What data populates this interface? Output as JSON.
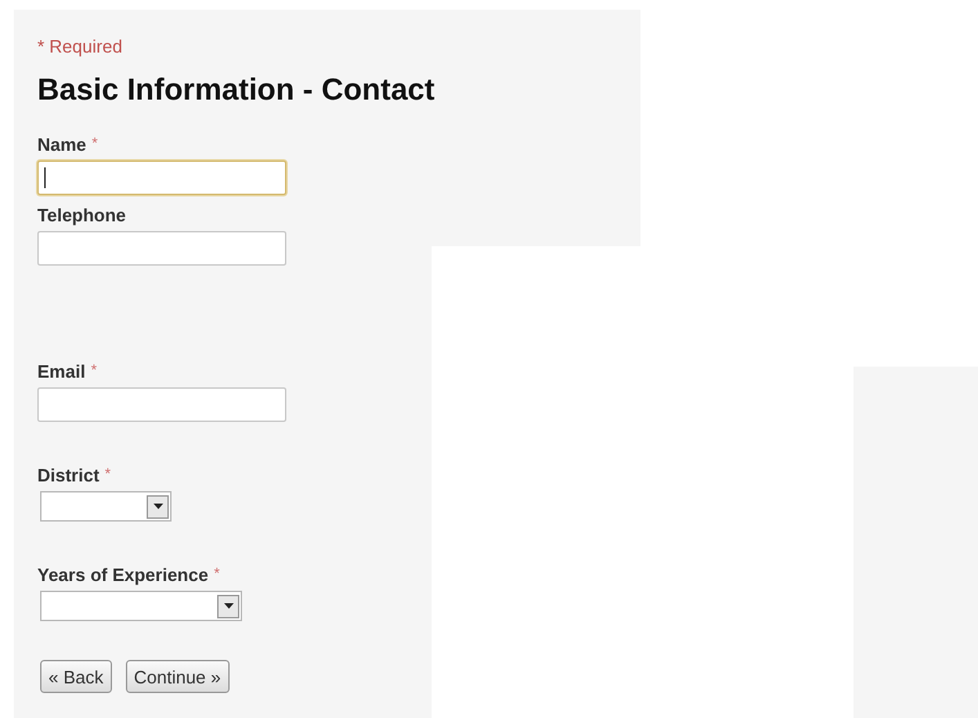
{
  "required_note": "* Required",
  "heading": "Basic Information - Contact",
  "fields": [
    {
      "label": "Name",
      "required": true,
      "kind": "text",
      "focused": true
    },
    {
      "label": "Telephone",
      "required": false,
      "kind": "text",
      "focused": false
    },
    {
      "label": "Email",
      "required": true,
      "kind": "text",
      "focused": false
    },
    {
      "label": "District",
      "required": true,
      "kind": "select"
    },
    {
      "label": "Years of Experience",
      "required": true,
      "kind": "wide-select"
    }
  ],
  "required_mark": "*",
  "buttons": [
    "« Back",
    "Continue »"
  ]
}
